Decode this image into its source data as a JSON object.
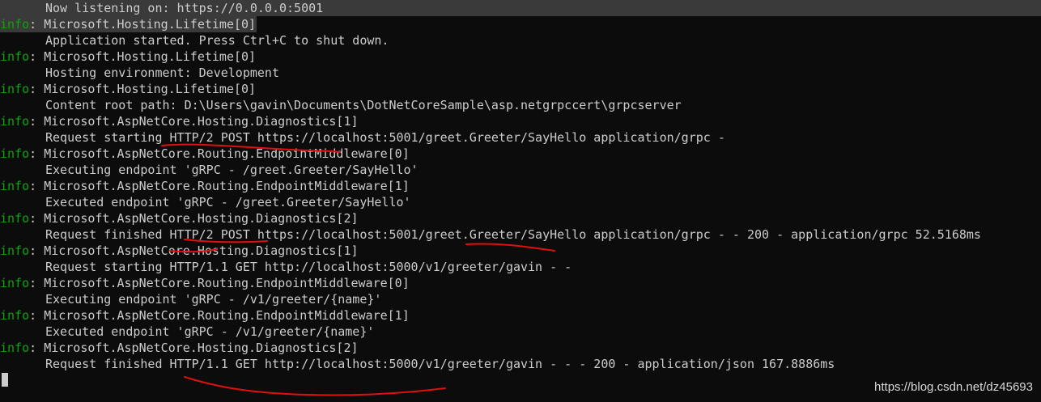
{
  "log_lines": [
    {
      "text": "Now listening on: https://0.0.0.0:5001"
    },
    {
      "level": "info",
      "sep": ": ",
      "text": "Microsoft.Hosting.Lifetime[0]"
    },
    {
      "text": "Application started. Press Ctrl+C to shut down."
    },
    {
      "level": "info",
      "sep": ": ",
      "text": "Microsoft.Hosting.Lifetime[0]"
    },
    {
      "text": "Hosting environment: Development"
    },
    {
      "level": "info",
      "sep": ": ",
      "text": "Microsoft.Hosting.Lifetime[0]"
    },
    {
      "text": "Content root path: D:\\Users\\gavin\\Documents\\DotNetCoreSample\\asp.netgrpccert\\grpcserver"
    },
    {
      "level": "info",
      "sep": ": ",
      "text": "Microsoft.AspNetCore.Hosting.Diagnostics[1]"
    },
    {
      "text": "Request starting HTTP/2 POST https://localhost:5001/greet.Greeter/SayHello application/grpc -"
    },
    {
      "level": "info",
      "sep": ": ",
      "text": "Microsoft.AspNetCore.Routing.EndpointMiddleware[0]"
    },
    {
      "text": "Executing endpoint 'gRPC - /greet.Greeter/SayHello'"
    },
    {
      "level": "info",
      "sep": ": ",
      "text": "Microsoft.AspNetCore.Routing.EndpointMiddleware[1]"
    },
    {
      "text": "Executed endpoint 'gRPC - /greet.Greeter/SayHello'"
    },
    {
      "level": "info",
      "sep": ": ",
      "text": "Microsoft.AspNetCore.Hosting.Diagnostics[2]"
    },
    {
      "text": "Request finished HTTP/2 POST https://localhost:5001/greet.Greeter/SayHello application/grpc - - 200 - application/grpc 52.5168ms"
    },
    {
      "level": "info",
      "sep": ": ",
      "text": "Microsoft.AspNetCore.Hosting.Diagnostics[1]"
    },
    {
      "text": "Request starting HTTP/1.1 GET http://localhost:5000/v1/greeter/gavin - -"
    },
    {
      "level": "info",
      "sep": ": ",
      "text": "Microsoft.AspNetCore.Routing.EndpointMiddleware[0]"
    },
    {
      "text": "Executing endpoint 'gRPC - /v1/greeter/{name}'"
    },
    {
      "level": "info",
      "sep": ": ",
      "text": "Microsoft.AspNetCore.Routing.EndpointMiddleware[1]"
    },
    {
      "text": "Executed endpoint 'gRPC - /v1/greeter/{name}'"
    },
    {
      "level": "info",
      "sep": ": ",
      "text": "Microsoft.AspNetCore.Hosting.Diagnostics[2]"
    },
    {
      "text": "Request finished HTTP/1.1 GET http://localhost:5000/v1/greeter/gavin - - - 200 - application/json 167.8886ms"
    }
  ],
  "watermark": "https://blog.csdn.net/dz45693",
  "colors": {
    "background": "#0c0c0c",
    "text": "#cccccc",
    "info": "#13a10e",
    "selection": "#3a3a3a",
    "annotation": "#e01010"
  }
}
